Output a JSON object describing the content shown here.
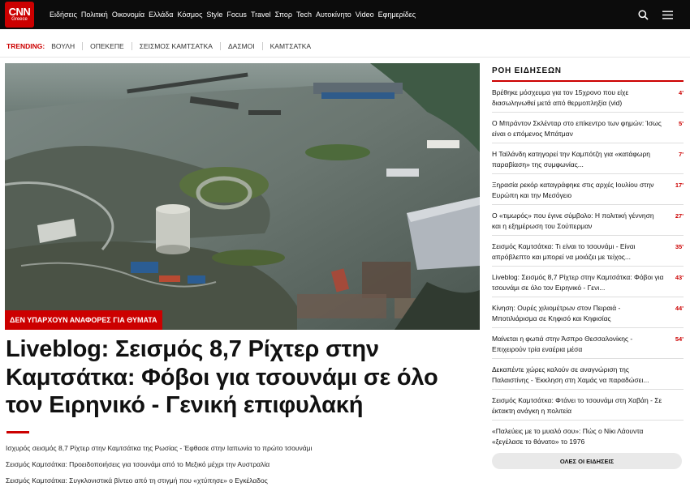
{
  "header": {
    "logo_top": "CNN",
    "logo_bottom": "Greece",
    "nav": [
      "Ειδήσεις",
      "Πολιτική",
      "Οικονομία",
      "Ελλάδα",
      "Κόσμος",
      "Style",
      "Focus",
      "Travel",
      "Σπορ",
      "Tech",
      "Αυτοκίνητο",
      "Video",
      "Εφημερίδες"
    ],
    "icons": [
      "search-icon",
      "menu-icon"
    ]
  },
  "trending": {
    "label": "TRENDING:",
    "items": [
      "ΒΟΥΛΗ",
      "ΟΠΕΚΕΠΕ",
      "ΣΕΙΣΜΟΣ ΚΑΜΤΣΑΤΚΑ",
      "ΔΑΣΜΟΙ",
      "ΚΑΜΤΣΑΤΚΑ"
    ]
  },
  "hero": {
    "tag": "ΔΕΝ ΥΠΑΡΧΟΥΝ ΑΝΑΦΟΡΕΣ ΓΙΑ ΘΥΜΑΤΑ",
    "headline": "Liveblog: Σεισμός 8,7 Ρίχτερ στην Καμτσάτκα: Φόβοι για τσουνάμι σε όλο τον Ειρηνικό - Γενική επιφυλακή",
    "related": [
      "Ισχυρός σεισμός 8,7 Ρίχτερ στην Καμτσάτκα της Ρωσίας - Έφθασε στην Ιαπωνία το πρώτο τσουνάμι",
      "Σεισμός Καμτσάτκα: Προειδοποιήσεις για τσουνάμι από το Μεξικό μέχρι την Αυστραλία",
      "Σεισμός Καμτσάτκα: Συγκλονιστικά βίντεο από τη στιγμή που «χτύπησε» ο Εγκέλαδος"
    ]
  },
  "feed": {
    "title": "ΡΟΗ ΕΙΔΗΣΕΩΝ",
    "items": [
      {
        "text": "Βρέθηκε μόσχευμα για τον 15χρονο που είχε διασωληνωθεί μετά από θερμοπληξία (vid)",
        "age": "4'"
      },
      {
        "text": "Ο Μπράντον Σκλένταρ στο επίκεντρο των φημών: Ίσως είναι ο επόμενος Μπάτμαν",
        "age": "5'"
      },
      {
        "text": "Η Ταϊλάνδη κατηγορεί την Καμπότζη για «κατάφωρη παραβίαση» της συμφωνίας...",
        "age": "7'"
      },
      {
        "text": "Ξηρασία ρεκόρ καταγράφηκε στις αρχές Ιουλίου στην Ευρώπη και την Μεσόγειο",
        "age": "17'"
      },
      {
        "text": "Ο «τιμωρός» που έγινε σύμβολο: Η πολιτική γέννηση και η εξημέρωση του Σούπερμαν",
        "age": "27'"
      },
      {
        "text": "Σεισμός Καμτσάτκα: Τι είναι το τσουνάμι - Είναι απρόβλεπτο και μπορεί να μοιάζει με τείχος...",
        "age": "35'"
      },
      {
        "text": "Liveblog: Σεισμός 8,7 Ρίχτερ στην Καμτσάτκα: Φόβοι για τσουνάμι σε όλο τον Ειρηνικό - Γενι...",
        "age": "43'"
      },
      {
        "text": "Κίνηση: Ουρές χιλιομέτρων στον Πειραιά - Μποτιλιάρισμα σε Κηφισό και Κηφισίας",
        "age": "44'"
      },
      {
        "text": "Μαίνεται η φωτιά στην Άσπρο Θεσσαλονίκης - Επιχειρούν τρία εναέρια μέσα",
        "age": "54'"
      },
      {
        "text": "Δεκαπέντε χώρες καλούν σε αναγνώριση της Παλαιστίνης - Έκκληση στη Χαμάς να παραδώσει...",
        "age": ""
      },
      {
        "text": "Σεισμός Καμτσάτκα: Φτάνει το τσουνάμι στη Χαβάη - Σε έκτακτη ανάγκη η πολιτεία",
        "age": ""
      },
      {
        "text": "«Παλεύεις με το μυαλό σου»: Πώς ο Νίκι Λάουντα «ξεγέλασε το θάνατο» το 1976",
        "age": ""
      }
    ],
    "all_news_label": "ΟΛΕΣ ΟΙ ΕΙΔΗΣΕΙΣ"
  },
  "colors": {
    "brand_red": "#cc0000",
    "header_bg": "#0c0c0c"
  }
}
